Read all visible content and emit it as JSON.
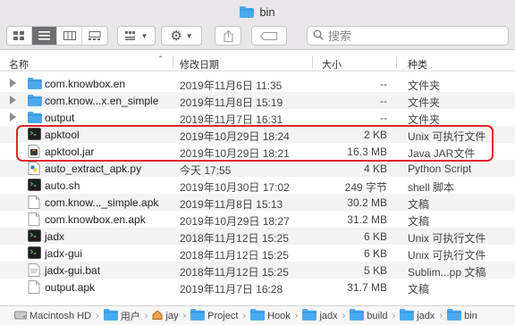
{
  "window": {
    "title": "bin"
  },
  "toolbar": {
    "view_icons": [
      "icon-view-icon",
      "list-view-icon",
      "column-view-icon",
      "gallery-view-icon"
    ],
    "active_view_index": 1,
    "search_placeholder": "搜索"
  },
  "columns": {
    "name": "名称",
    "date": "修改日期",
    "size": "大小",
    "kind": "种类"
  },
  "files": [
    {
      "name": "com.knowbox.en",
      "date": "2019年11月6日 11:35",
      "size": "--",
      "kind": "文件夹",
      "icon": "folder-icon",
      "expandable": true
    },
    {
      "name": "com.know...x.en_simple",
      "date": "2019年11月8日 15:19",
      "size": "--",
      "kind": "文件夹",
      "icon": "folder-icon",
      "expandable": true
    },
    {
      "name": "output",
      "date": "2019年11月7日 16:31",
      "size": "--",
      "kind": "文件夹",
      "icon": "folder-icon",
      "expandable": true
    },
    {
      "name": "apktool",
      "date": "2019年10月29日 18:24",
      "size": "2 KB",
      "kind": "Unix 可执行文件",
      "icon": "terminal-icon",
      "expandable": false
    },
    {
      "name": "apktool.jar",
      "date": "2019年10月29日 18:21",
      "size": "16.3 MB",
      "kind": "Java JAR文件",
      "icon": "jar-icon",
      "expandable": false
    },
    {
      "name": "auto_extract_apk.py",
      "date": "今天 17:55",
      "size": "4 KB",
      "kind": "Python Script",
      "icon": "python-icon",
      "expandable": false
    },
    {
      "name": "auto.sh",
      "date": "2019年10月30日 17:02",
      "size": "249 字节",
      "kind": "shell 脚本",
      "icon": "terminal-icon",
      "expandable": false
    },
    {
      "name": "com.know..._simple.apk",
      "date": "2019年11月8日 15:13",
      "size": "30.2 MB",
      "kind": "文稿",
      "icon": "document-icon",
      "expandable": false
    },
    {
      "name": "com.knowbox.en.apk",
      "date": "2019年10月29日 18:27",
      "size": "31.2 MB",
      "kind": "文稿",
      "icon": "document-icon",
      "expandable": false
    },
    {
      "name": "jadx",
      "date": "2018年11月12日 15:25",
      "size": "6 KB",
      "kind": "Unix 可执行文件",
      "icon": "terminal-icon",
      "expandable": false
    },
    {
      "name": "jadx-gui",
      "date": "2018年11月12日 15:25",
      "size": "6 KB",
      "kind": "Unix 可执行文件",
      "icon": "terminal-icon",
      "expandable": false
    },
    {
      "name": "jadx-gui.bat",
      "date": "2018年11月12日 15:25",
      "size": "5 KB",
      "kind": "Sublim...pp 文稿",
      "icon": "text-file-icon",
      "expandable": false
    },
    {
      "name": "output.apk",
      "date": "2019年11月7日 16:28",
      "size": "31.7 MB",
      "kind": "文稿",
      "icon": "document-icon",
      "expandable": false
    }
  ],
  "highlight": {
    "color": "#e0252b"
  },
  "path": [
    {
      "label": "Macintosh HD",
      "icon": "hard-drive-icon"
    },
    {
      "label": "用户",
      "icon": "folder-icon"
    },
    {
      "label": "jay",
      "icon": "home-icon"
    },
    {
      "label": "Project",
      "icon": "folder-icon"
    },
    {
      "label": "Hook",
      "icon": "folder-icon"
    },
    {
      "label": "jadx",
      "icon": "folder-icon"
    },
    {
      "label": "build",
      "icon": "folder-icon"
    },
    {
      "label": "jadx",
      "icon": "folder-icon"
    },
    {
      "label": "bin",
      "icon": "folder-icon"
    }
  ],
  "colors": {
    "folder": "#4aa8ec",
    "toolbar_bg": "#e8e6e8",
    "active_segment": "#6f6e70"
  }
}
